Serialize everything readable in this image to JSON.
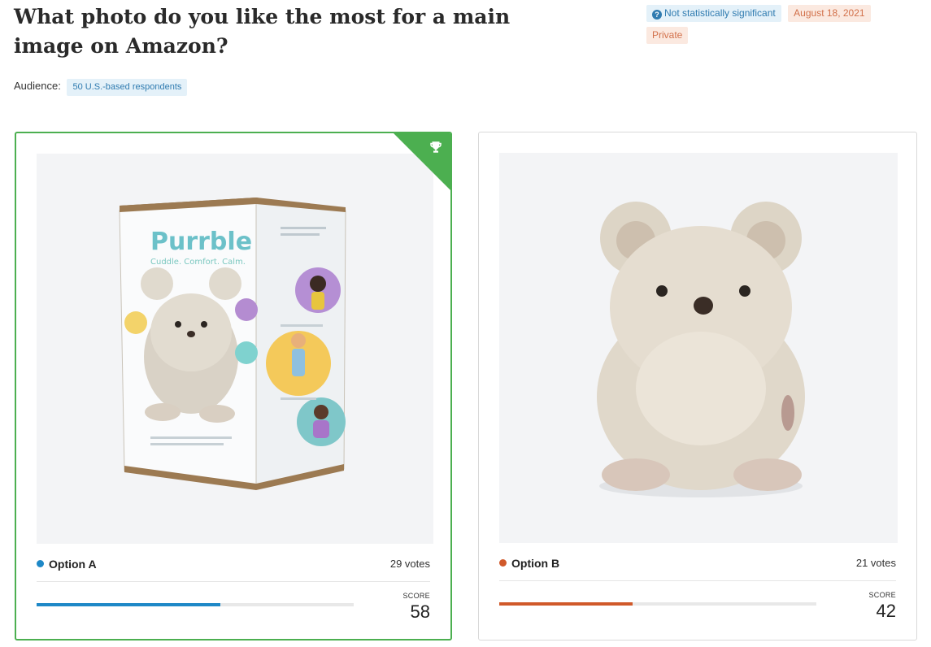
{
  "title": "What photo do you like the most for a main image on Amazon?",
  "badges": {
    "significance": "Not statistically significant",
    "date": "August 18, 2021",
    "visibility": "Private"
  },
  "audience": {
    "label": "Audience:",
    "value": "50 U.S.-based respondents"
  },
  "options": [
    {
      "label": "Option A",
      "votes": "29 votes",
      "score_label": "SCORE",
      "score": "58",
      "progress": 0.58,
      "color": "#1e88c7",
      "winner": true,
      "box_text": {
        "brand": "Purrble",
        "tagline": "Cuddle. Comfort. Calm."
      }
    },
    {
      "label": "Option B",
      "votes": "21 votes",
      "score_label": "SCORE",
      "score": "42",
      "progress": 0.42,
      "color": "#d0592a",
      "winner": false
    }
  ],
  "colors": {
    "winner_border": "#4caf50",
    "badge_blue": "#2f7bb0",
    "badge_peach": "#d2704a"
  },
  "icons": {
    "significance": "question-circle-icon",
    "winner": "trophy-icon"
  }
}
